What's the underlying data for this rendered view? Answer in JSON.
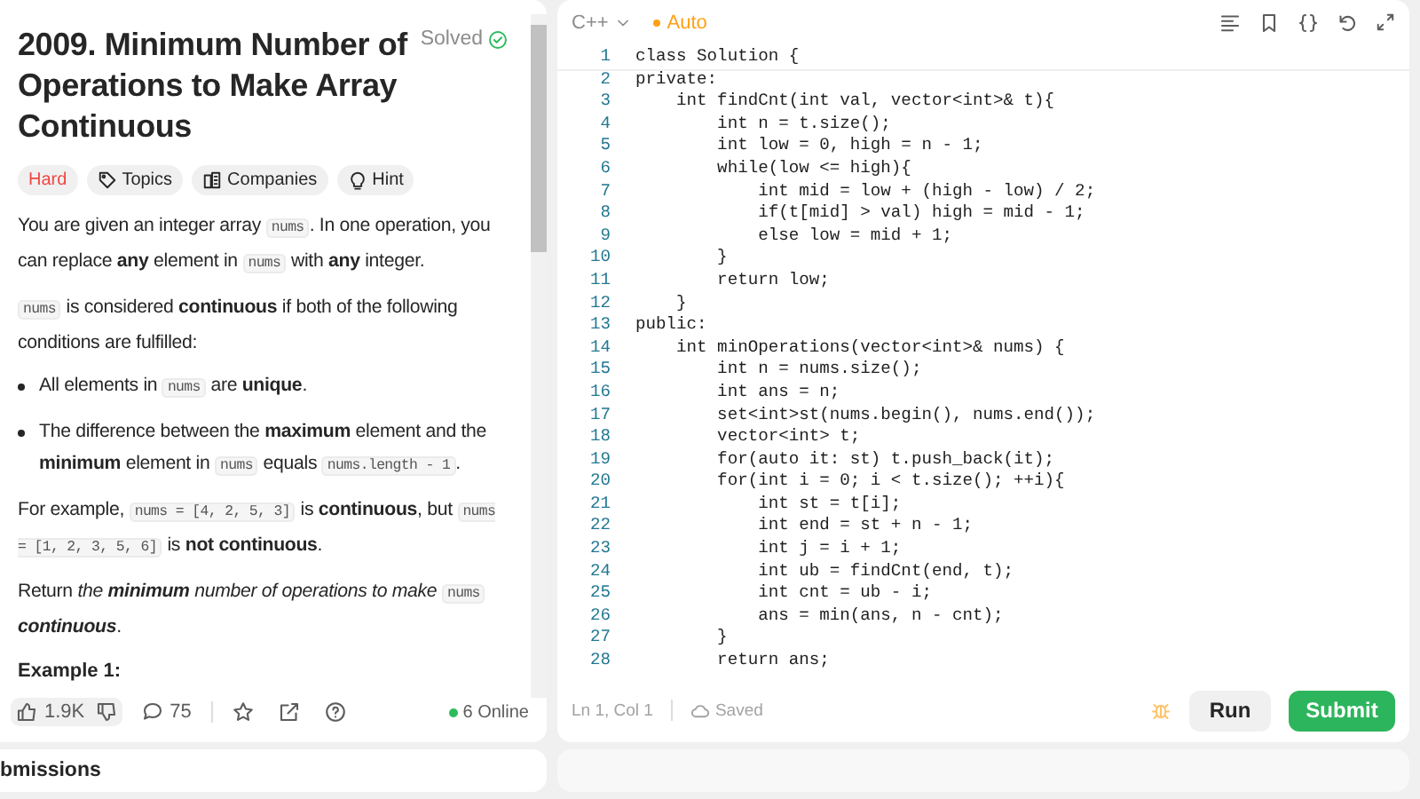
{
  "problem": {
    "title": "2009. Minimum Number of Operations to Make Array Continuous",
    "status": "Solved",
    "tags": [
      {
        "kind": "difficulty",
        "label": "Hard"
      },
      {
        "kind": "topics",
        "label": "Topics"
      },
      {
        "kind": "companies",
        "label": "Companies"
      },
      {
        "kind": "hint",
        "label": "Hint"
      }
    ],
    "description": [
      {
        "kind": "paragraph",
        "parts": [
          {
            "kind": "text",
            "text": "You are given an integer array "
          },
          {
            "kind": "code",
            "text": "nums"
          },
          {
            "kind": "text",
            "text": ". In one operation, you can replace **any** element in "
          },
          {
            "kind": "code",
            "text": "nums"
          },
          {
            "kind": "text",
            "text": " with **any** integer."
          }
        ]
      },
      {
        "kind": "paragraph",
        "parts": [
          {
            "kind": "code",
            "text": "nums"
          },
          {
            "kind": "text",
            "text": " is considered **continuous** if both of the following conditions are fulfilled:"
          }
        ]
      },
      {
        "kind": "bullet",
        "parts": [
          {
            "kind": "text",
            "text": "All elements in "
          },
          {
            "kind": "code",
            "text": "nums"
          },
          {
            "kind": "text",
            "text": " are **unique**."
          }
        ]
      },
      {
        "kind": "bullet",
        "parts": [
          {
            "kind": "text",
            "text": "The difference between the **maximum** element and the **minimum** element in "
          },
          {
            "kind": "code",
            "text": "nums"
          },
          {
            "kind": "text",
            "text": " equals "
          },
          {
            "kind": "code",
            "text": "nums.length - 1"
          },
          {
            "kind": "text",
            "text": "."
          }
        ]
      },
      {
        "kind": "paragraph",
        "parts": [
          {
            "kind": "text",
            "text": "For example, "
          },
          {
            "kind": "code",
            "text": "nums = [4, 2, 5, 3]"
          },
          {
            "kind": "text",
            "text": " is **continuous**, but "
          },
          {
            "kind": "code",
            "text": "nums = [1, 2, 3, 5, 6]"
          },
          {
            "kind": "text",
            "text": " is **not continuous**."
          }
        ]
      },
      {
        "kind": "paragraph",
        "parts": [
          {
            "kind": "text",
            "text": "Return "
          },
          {
            "kind": "text",
            "italic": true,
            "text": "the **minimum** number of operations to make "
          },
          {
            "kind": "code",
            "text": "nums"
          },
          {
            "kind": "text",
            "italic": true,
            "text": " **continuous**"
          },
          {
            "kind": "text",
            "text": "."
          }
        ]
      },
      {
        "kind": "heading",
        "parts": [
          {
            "kind": "text",
            "text": "Example 1:"
          }
        ]
      }
    ],
    "footer": {
      "likes": "1.9K",
      "comments": "75",
      "online": "6 Online"
    }
  },
  "editor": {
    "language": "C++",
    "mode": "Auto",
    "lines": [
      {
        "number": "1",
        "code": "class Solution {"
      },
      {
        "number": "2",
        "code": "private:"
      },
      {
        "number": "3",
        "code": "    int findCnt(int val, vector<int>& t){"
      },
      {
        "number": "4",
        "code": "        int n = t.size();"
      },
      {
        "number": "5",
        "code": "        int low = 0, high = n - 1;"
      },
      {
        "number": "6",
        "code": "        while(low <= high){"
      },
      {
        "number": "7",
        "code": "            int mid = low + (high - low) / 2;"
      },
      {
        "number": "8",
        "code": "            if(t[mid] > val) high = mid - 1;"
      },
      {
        "number": "9",
        "code": "            else low = mid + 1;"
      },
      {
        "number": "10",
        "code": "        }"
      },
      {
        "number": "11",
        "code": "        return low;"
      },
      {
        "number": "12",
        "code": "    }"
      },
      {
        "number": "13",
        "code": "public:"
      },
      {
        "number": "14",
        "code": "    int minOperations(vector<int>& nums) {"
      },
      {
        "number": "15",
        "code": "        int n = nums.size();"
      },
      {
        "number": "16",
        "code": "        int ans = n;"
      },
      {
        "number": "17",
        "code": "        set<int>st(nums.begin(), nums.end());"
      },
      {
        "number": "18",
        "code": "        vector<int> t;"
      },
      {
        "number": "19",
        "code": "        for(auto it: st) t.push_back(it);"
      },
      {
        "number": "20",
        "code": "        for(int i = 0; i < t.size(); ++i){"
      },
      {
        "number": "21",
        "code": "            int st = t[i];"
      },
      {
        "number": "22",
        "code": "            int end = st + n - 1;"
      },
      {
        "number": "23",
        "code": "            int j = i + 1;"
      },
      {
        "number": "24",
        "code": "            int ub = findCnt(end, t);"
      },
      {
        "number": "25",
        "code": "            int cnt = ub - i;"
      },
      {
        "number": "26",
        "code": "            ans = min(ans, n - cnt);"
      },
      {
        "number": "27",
        "code": "        }"
      },
      {
        "number": "28",
        "code": "        return ans;"
      }
    ],
    "cursor": "Ln 1, Col 1",
    "save_status": "Saved",
    "buttons": [
      {
        "kind": "run",
        "label": "Run"
      },
      {
        "kind": "submit",
        "label": "Submit"
      }
    ]
  },
  "bottom_panel": {
    "title": "bmissions"
  }
}
